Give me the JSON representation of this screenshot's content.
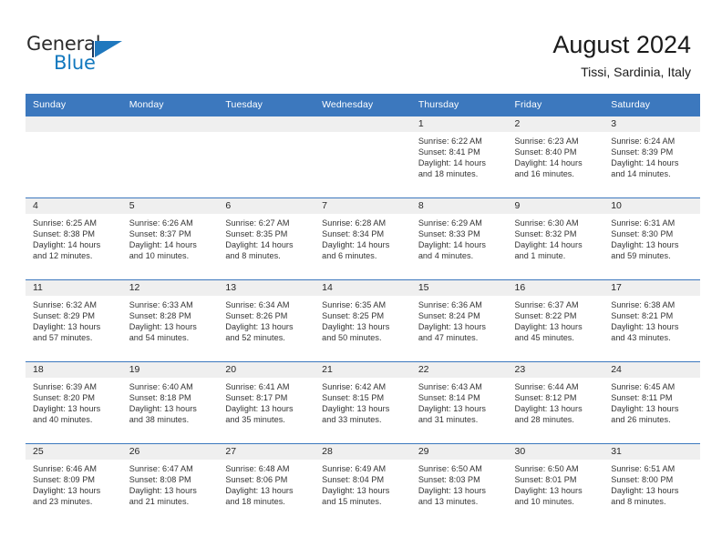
{
  "brand": {
    "name_part1": "General",
    "name_part2": "Blue",
    "logo_icon": "triangle-logo-icon",
    "accent_color": "#1f78be"
  },
  "header": {
    "title": "August 2024",
    "location": "Tissi, Sardinia, Italy"
  },
  "theme": {
    "header_blue": "#3c78be",
    "row_shade": "#efefef",
    "text": "#333333"
  },
  "calendar": {
    "weekdays": [
      "Sunday",
      "Monday",
      "Tuesday",
      "Wednesday",
      "Thursday",
      "Friday",
      "Saturday"
    ],
    "labels": {
      "sunrise": "Sunrise:",
      "sunset": "Sunset:",
      "daylight": "Daylight:"
    },
    "weeks": [
      [
        {
          "day": "",
          "sunrise": "",
          "sunset": "",
          "daylight_line1": "",
          "daylight_line2": ""
        },
        {
          "day": "",
          "sunrise": "",
          "sunset": "",
          "daylight_line1": "",
          "daylight_line2": ""
        },
        {
          "day": "",
          "sunrise": "",
          "sunset": "",
          "daylight_line1": "",
          "daylight_line2": ""
        },
        {
          "day": "",
          "sunrise": "",
          "sunset": "",
          "daylight_line1": "",
          "daylight_line2": ""
        },
        {
          "day": "1",
          "sunrise": "Sunrise: 6:22 AM",
          "sunset": "Sunset: 8:41 PM",
          "daylight_line1": "Daylight: 14 hours",
          "daylight_line2": "and 18 minutes."
        },
        {
          "day": "2",
          "sunrise": "Sunrise: 6:23 AM",
          "sunset": "Sunset: 8:40 PM",
          "daylight_line1": "Daylight: 14 hours",
          "daylight_line2": "and 16 minutes."
        },
        {
          "day": "3",
          "sunrise": "Sunrise: 6:24 AM",
          "sunset": "Sunset: 8:39 PM",
          "daylight_line1": "Daylight: 14 hours",
          "daylight_line2": "and 14 minutes."
        }
      ],
      [
        {
          "day": "4",
          "sunrise": "Sunrise: 6:25 AM",
          "sunset": "Sunset: 8:38 PM",
          "daylight_line1": "Daylight: 14 hours",
          "daylight_line2": "and 12 minutes."
        },
        {
          "day": "5",
          "sunrise": "Sunrise: 6:26 AM",
          "sunset": "Sunset: 8:37 PM",
          "daylight_line1": "Daylight: 14 hours",
          "daylight_line2": "and 10 minutes."
        },
        {
          "day": "6",
          "sunrise": "Sunrise: 6:27 AM",
          "sunset": "Sunset: 8:35 PM",
          "daylight_line1": "Daylight: 14 hours",
          "daylight_line2": "and 8 minutes."
        },
        {
          "day": "7",
          "sunrise": "Sunrise: 6:28 AM",
          "sunset": "Sunset: 8:34 PM",
          "daylight_line1": "Daylight: 14 hours",
          "daylight_line2": "and 6 minutes."
        },
        {
          "day": "8",
          "sunrise": "Sunrise: 6:29 AM",
          "sunset": "Sunset: 8:33 PM",
          "daylight_line1": "Daylight: 14 hours",
          "daylight_line2": "and 4 minutes."
        },
        {
          "day": "9",
          "sunrise": "Sunrise: 6:30 AM",
          "sunset": "Sunset: 8:32 PM",
          "daylight_line1": "Daylight: 14 hours",
          "daylight_line2": "and 1 minute."
        },
        {
          "day": "10",
          "sunrise": "Sunrise: 6:31 AM",
          "sunset": "Sunset: 8:30 PM",
          "daylight_line1": "Daylight: 13 hours",
          "daylight_line2": "and 59 minutes."
        }
      ],
      [
        {
          "day": "11",
          "sunrise": "Sunrise: 6:32 AM",
          "sunset": "Sunset: 8:29 PM",
          "daylight_line1": "Daylight: 13 hours",
          "daylight_line2": "and 57 minutes."
        },
        {
          "day": "12",
          "sunrise": "Sunrise: 6:33 AM",
          "sunset": "Sunset: 8:28 PM",
          "daylight_line1": "Daylight: 13 hours",
          "daylight_line2": "and 54 minutes."
        },
        {
          "day": "13",
          "sunrise": "Sunrise: 6:34 AM",
          "sunset": "Sunset: 8:26 PM",
          "daylight_line1": "Daylight: 13 hours",
          "daylight_line2": "and 52 minutes."
        },
        {
          "day": "14",
          "sunrise": "Sunrise: 6:35 AM",
          "sunset": "Sunset: 8:25 PM",
          "daylight_line1": "Daylight: 13 hours",
          "daylight_line2": "and 50 minutes."
        },
        {
          "day": "15",
          "sunrise": "Sunrise: 6:36 AM",
          "sunset": "Sunset: 8:24 PM",
          "daylight_line1": "Daylight: 13 hours",
          "daylight_line2": "and 47 minutes."
        },
        {
          "day": "16",
          "sunrise": "Sunrise: 6:37 AM",
          "sunset": "Sunset: 8:22 PM",
          "daylight_line1": "Daylight: 13 hours",
          "daylight_line2": "and 45 minutes."
        },
        {
          "day": "17",
          "sunrise": "Sunrise: 6:38 AM",
          "sunset": "Sunset: 8:21 PM",
          "daylight_line1": "Daylight: 13 hours",
          "daylight_line2": "and 43 minutes."
        }
      ],
      [
        {
          "day": "18",
          "sunrise": "Sunrise: 6:39 AM",
          "sunset": "Sunset: 8:20 PM",
          "daylight_line1": "Daylight: 13 hours",
          "daylight_line2": "and 40 minutes."
        },
        {
          "day": "19",
          "sunrise": "Sunrise: 6:40 AM",
          "sunset": "Sunset: 8:18 PM",
          "daylight_line1": "Daylight: 13 hours",
          "daylight_line2": "and 38 minutes."
        },
        {
          "day": "20",
          "sunrise": "Sunrise: 6:41 AM",
          "sunset": "Sunset: 8:17 PM",
          "daylight_line1": "Daylight: 13 hours",
          "daylight_line2": "and 35 minutes."
        },
        {
          "day": "21",
          "sunrise": "Sunrise: 6:42 AM",
          "sunset": "Sunset: 8:15 PM",
          "daylight_line1": "Daylight: 13 hours",
          "daylight_line2": "and 33 minutes."
        },
        {
          "day": "22",
          "sunrise": "Sunrise: 6:43 AM",
          "sunset": "Sunset: 8:14 PM",
          "daylight_line1": "Daylight: 13 hours",
          "daylight_line2": "and 31 minutes."
        },
        {
          "day": "23",
          "sunrise": "Sunrise: 6:44 AM",
          "sunset": "Sunset: 8:12 PM",
          "daylight_line1": "Daylight: 13 hours",
          "daylight_line2": "and 28 minutes."
        },
        {
          "day": "24",
          "sunrise": "Sunrise: 6:45 AM",
          "sunset": "Sunset: 8:11 PM",
          "daylight_line1": "Daylight: 13 hours",
          "daylight_line2": "and 26 minutes."
        }
      ],
      [
        {
          "day": "25",
          "sunrise": "Sunrise: 6:46 AM",
          "sunset": "Sunset: 8:09 PM",
          "daylight_line1": "Daylight: 13 hours",
          "daylight_line2": "and 23 minutes."
        },
        {
          "day": "26",
          "sunrise": "Sunrise: 6:47 AM",
          "sunset": "Sunset: 8:08 PM",
          "daylight_line1": "Daylight: 13 hours",
          "daylight_line2": "and 21 minutes."
        },
        {
          "day": "27",
          "sunrise": "Sunrise: 6:48 AM",
          "sunset": "Sunset: 8:06 PM",
          "daylight_line1": "Daylight: 13 hours",
          "daylight_line2": "and 18 minutes."
        },
        {
          "day": "28",
          "sunrise": "Sunrise: 6:49 AM",
          "sunset": "Sunset: 8:04 PM",
          "daylight_line1": "Daylight: 13 hours",
          "daylight_line2": "and 15 minutes."
        },
        {
          "day": "29",
          "sunrise": "Sunrise: 6:50 AM",
          "sunset": "Sunset: 8:03 PM",
          "daylight_line1": "Daylight: 13 hours",
          "daylight_line2": "and 13 minutes."
        },
        {
          "day": "30",
          "sunrise": "Sunrise: 6:50 AM",
          "sunset": "Sunset: 8:01 PM",
          "daylight_line1": "Daylight: 13 hours",
          "daylight_line2": "and 10 minutes."
        },
        {
          "day": "31",
          "sunrise": "Sunrise: 6:51 AM",
          "sunset": "Sunset: 8:00 PM",
          "daylight_line1": "Daylight: 13 hours",
          "daylight_line2": "and 8 minutes."
        }
      ]
    ]
  }
}
